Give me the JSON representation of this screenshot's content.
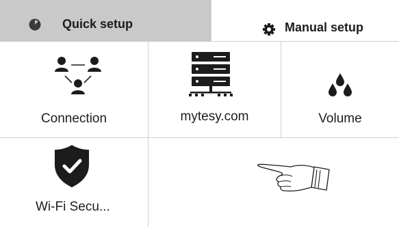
{
  "tabs": {
    "quick": {
      "label": "Quick setup",
      "icon": "clock-icon",
      "active": true
    },
    "manual": {
      "label": "Manual setup",
      "icon": "gear-icon",
      "active": false
    }
  },
  "tiles": [
    {
      "label": "Connection",
      "icon": "network-users-icon"
    },
    {
      "label": "mytesy.com",
      "icon": "server-icon"
    },
    {
      "label": "Volume",
      "icon": "water-drops-icon"
    },
    {
      "label": "Wi-Fi Secu...",
      "icon": "shield-check-icon"
    }
  ],
  "pointer": {
    "icon": "pointing-hand-icon"
  },
  "colors": {
    "active_tab_bg": "#c9c9c9",
    "icon": "#1c1c1c",
    "divider": "#d0d0d0"
  }
}
